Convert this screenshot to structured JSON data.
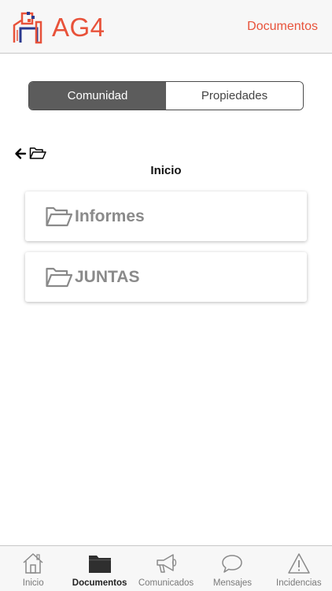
{
  "header": {
    "brand": "AG4",
    "title": "Documentos",
    "logo_icon": "building-logo-icon",
    "accent_color": "#e8523a"
  },
  "segmented": {
    "options": [
      {
        "label": "Comunidad",
        "active": true
      },
      {
        "label": "Propiedades",
        "active": false
      }
    ]
  },
  "navigation": {
    "back_icon": "arrow-left-icon",
    "folder_icon": "folder-open-icon",
    "current_path": "Inicio"
  },
  "folders": [
    {
      "name": "Informes",
      "icon": "folder-open-icon"
    },
    {
      "name": "JUNTAS",
      "icon": "folder-open-icon"
    }
  ],
  "tabbar": {
    "tabs": [
      {
        "label": "Inicio",
        "icon": "house-icon",
        "active": false
      },
      {
        "label": "Documentos",
        "icon": "folder-icon",
        "active": true
      },
      {
        "label": "Comunicados",
        "icon": "megaphone-icon",
        "active": false
      },
      {
        "label": "Mensajes",
        "icon": "speech-bubble-icon",
        "active": false
      },
      {
        "label": "Incidencias",
        "icon": "warning-icon",
        "active": false
      }
    ]
  }
}
